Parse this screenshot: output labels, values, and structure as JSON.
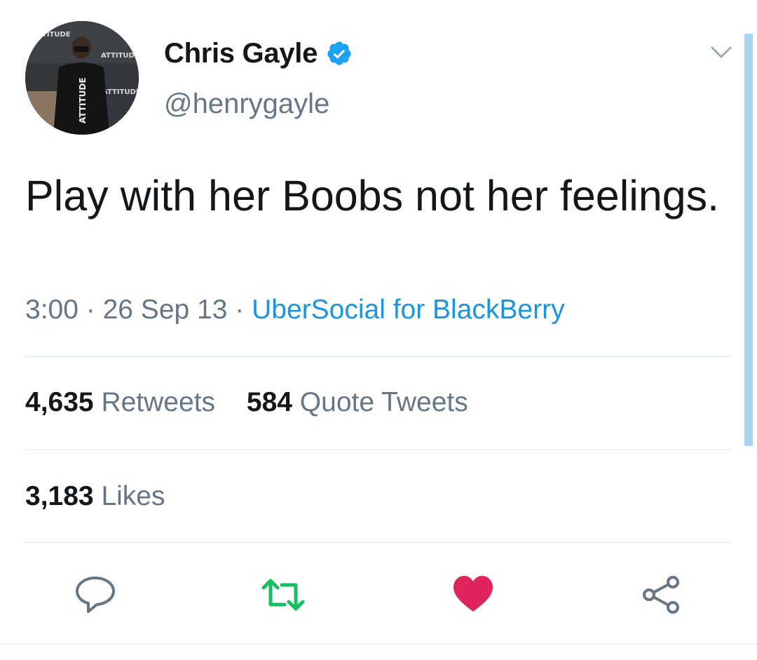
{
  "user": {
    "display_name": "Chris Gayle",
    "handle": "@henrygayle",
    "verified": true,
    "avatar_text": "ATTITUDE"
  },
  "tweet": {
    "text": "Play with her Boobs not her feelings.",
    "time": "3:00",
    "date": "26 Sep 13",
    "separator": "·",
    "source": "UberSocial for BlackBerry"
  },
  "stats": {
    "retweets_count": "4,635",
    "retweets_label": "Retweets",
    "quotes_count": "584",
    "quotes_label": "Quote Tweets",
    "likes_count": "3,183",
    "likes_label": "Likes"
  },
  "actions": {
    "reply_icon": "reply-icon",
    "retweet_icon": "retweet-icon",
    "like_icon": "heart-icon",
    "share_icon": "share-icon"
  },
  "colors": {
    "link": "#1b95e0",
    "verified": "#1da1f2",
    "retweet": "#17bf63",
    "like": "#e0245e",
    "secondary_text": "#657786"
  }
}
